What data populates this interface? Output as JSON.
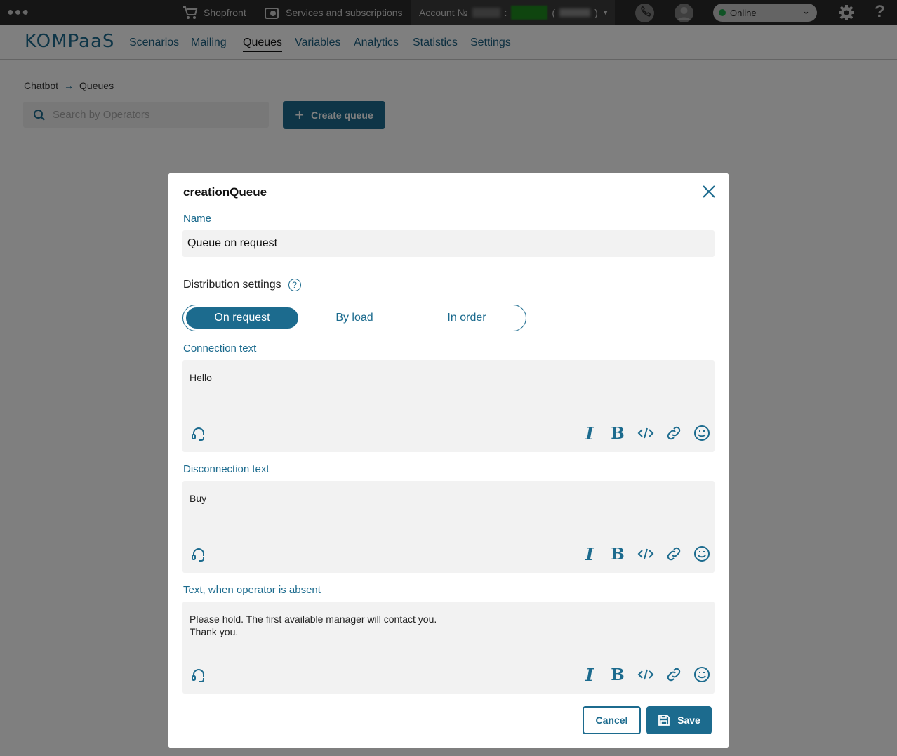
{
  "topbar": {
    "shop_label": "Shopfront",
    "services_label": "Services and subscriptions",
    "account_label": "Account №",
    "status_value": "Online"
  },
  "nav": {
    "logo": "KOMPaaS",
    "items": [
      "Scenarios",
      "Mailing",
      "Queues",
      "Variables",
      "Analytics",
      "Statistics",
      "Settings"
    ]
  },
  "breadcrumb": {
    "root": "Chatbot",
    "current": "Queues"
  },
  "search": {
    "placeholder": "Search by Operators"
  },
  "create_button": "Create queue",
  "modal": {
    "title": "creationQueue",
    "name_label": "Name",
    "name_value": "Queue on request",
    "distribution_label": "Distribution settings",
    "distribution_options": [
      "On request",
      "By load",
      "In order"
    ],
    "distribution_selected": "On request",
    "connection_label": "Connection text",
    "connection_value": "Hello",
    "disconnection_label": "Disconnection text",
    "disconnection_value": "Buy",
    "absent_label": "Text, when operator is absent",
    "absent_value": "Please hold. The first available manager will contact you.\nThank you.",
    "cancel_label": "Cancel",
    "save_label": "Save"
  },
  "colors": {
    "accent": "#1c6b8e",
    "online": "#1fa64a"
  }
}
